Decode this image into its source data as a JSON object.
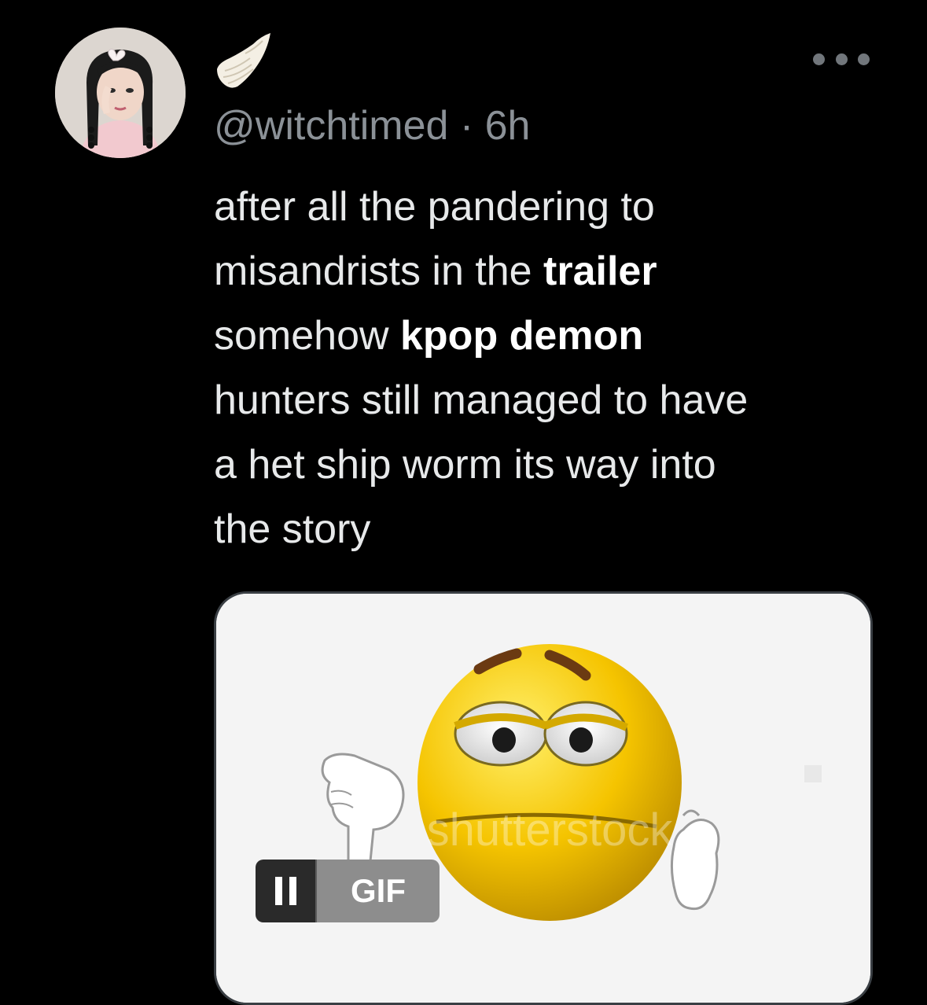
{
  "tweet": {
    "handle": "@witchtimed",
    "separator": " · ",
    "time": "6h",
    "lines": [
      [
        {
          "t": "after all the pandering to",
          "b": false
        }
      ],
      [
        {
          "t": "misandrists in the ",
          "b": false
        },
        {
          "t": "trailer",
          "b": true
        }
      ],
      [
        {
          "t": "somehow ",
          "b": false
        },
        {
          "t": "kpop demon",
          "b": true
        }
      ],
      [
        {
          "t": "hunters still managed to have",
          "b": false
        }
      ],
      [
        {
          "t": "a het ship worm its way into",
          "b": false
        }
      ],
      [
        {
          "t": "the story",
          "b": false
        }
      ]
    ]
  },
  "media": {
    "type": "gif",
    "badge_label": "GIF",
    "watermark": "shutterstock"
  },
  "icons": {
    "more": "more-horizontal-icon",
    "pause": "pause-icon",
    "name_emoji": "wing-icon"
  },
  "colors": {
    "background": "#000000",
    "text": "#e7e9ea",
    "secondary_text": "#8b9197",
    "media_border": "#3a3f44",
    "emoji_yellow": "#f5c400"
  }
}
